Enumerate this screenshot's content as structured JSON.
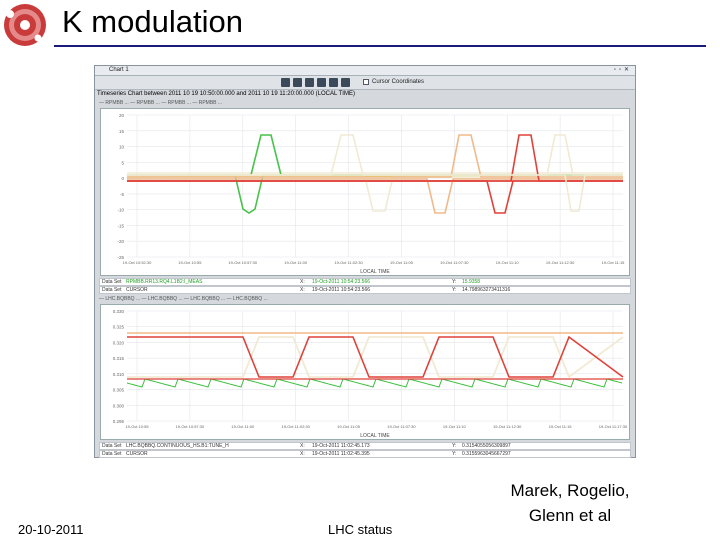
{
  "slide": {
    "title": "K modulation",
    "author_line1": "Marek, Rogelio,",
    "author_line2": "Glenn et al",
    "date": "20-10-2011",
    "status": "LHC status"
  },
  "window": {
    "title": "Chart 1",
    "cursor_label": "Cursor Coordinates",
    "chart_header": "Timeseries Chart between 2011  10  19 10:50:00.000 and 2011  10  19 11:20:00.000 (LOCAL TIME)"
  },
  "top_chart": {
    "x_axis_label": "LOCAL TIME",
    "y_ticks": [
      "20",
      "15",
      "10",
      "5",
      "0",
      "-5",
      "-10",
      "-15",
      "-20",
      "-25"
    ],
    "x_ticks": [
      "19-Oct 10:52:30",
      "19-Oct 10:55",
      "19-Oct 10:57:30",
      "19-Oct 11:00",
      "19-Oct 11:02:30",
      "19-Oct 11:05",
      "19-Oct 11:07:30",
      "19-Oct 11:10",
      "19-Oct 11:12:30",
      "19-Oct 11:15"
    ],
    "dataset_row1": {
      "label": "Data Set",
      "name": "RPMBB.RR13.RQ4.L1B2:I_MEAS",
      "x_label": "X:",
      "x": "19-Oct-2011 10:54:23.566",
      "y_label": "Y:",
      "y": "15.9358"
    },
    "dataset_row2": {
      "label": "Data Set",
      "name": "CURSOR",
      "x_label": "X:",
      "x": "19-Oct-2011 10:54:23.566",
      "y_label": "Y:",
      "y": "14.798963273411316"
    },
    "colors": {
      "green": "#47c24a",
      "peach": "#f0b98a",
      "red": "#e0413a",
      "yellow": "#d8d240",
      "beige": "#f1ead3"
    }
  },
  "bottom_chart": {
    "x_axis_label": "LOCAL TIME",
    "y_ticks": [
      "0.330",
      "0.325",
      "0.320",
      "0.315",
      "0.310",
      "0.305",
      "0.300",
      "0.295"
    ],
    "x_ticks": [
      "19-Oct 10:55",
      "19-Oct 10:57:30",
      "19-Oct 11:00",
      "19-Oct 11:02:30",
      "19-Oct 11:05",
      "19-Oct 11:07:30",
      "19-Oct 11:10",
      "19-Oct 11:12:30",
      "19-Oct 11:15",
      "19-Oct 11:17:30"
    ],
    "dataset_row1": {
      "label": "Data Set",
      "name": "LHC.BQBBQ.CONTINUOUS_HS.B1:TUNE_H",
      "x_label": "X:",
      "x": "19-Oct-2011 11:02:45.173",
      "y_label": "Y:",
      "y": "0.3154055056309897"
    },
    "dataset_row2": {
      "label": "Data Set",
      "name": "CURSOR",
      "x_label": "X:",
      "x": "19-Oct-2011 11:02:45.395",
      "y_label": "Y:",
      "y": "0.3155963045667297"
    },
    "colors": {
      "green": "#3cbf3c",
      "peach": "#f0b98a",
      "red": "#e0413a",
      "beige": "#f1ead3"
    }
  }
}
